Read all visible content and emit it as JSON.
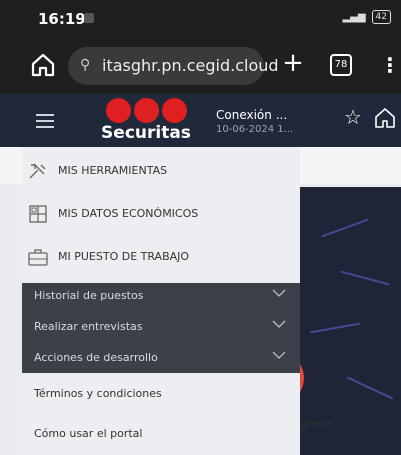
{
  "status_bar": {
    "time": "16:19",
    "battery": "42"
  },
  "browser": {
    "url": "itasghr.pn.cegid.cloud",
    "tab_count": "78",
    "new_tab": "+",
    "menu": "⋮"
  },
  "header": {
    "brand": "Securitas",
    "connection_label": "Conexión ...",
    "connection_date": "10-06-2024 1...",
    "brand_color": "#e02020"
  },
  "drawer": {
    "tools": [
      {
        "label": "MIS HERRAMIENTAS",
        "icon": "tools-icon"
      },
      {
        "label": "MIS DATOS ECONÓMICOS",
        "icon": "calculator-icon"
      },
      {
        "label": "MI PUESTO DE TRABAJO",
        "icon": "briefcase-icon"
      }
    ],
    "sections": [
      {
        "label": "Historial de puestos"
      },
      {
        "label": "Realizar entrevistas"
      },
      {
        "label": "Acciones de desarrollo"
      }
    ],
    "links": [
      {
        "label": "Términos y condiciones"
      },
      {
        "label": "Cómo usar el portal"
      }
    ]
  },
  "background": {
    "partial_text": "gente"
  }
}
